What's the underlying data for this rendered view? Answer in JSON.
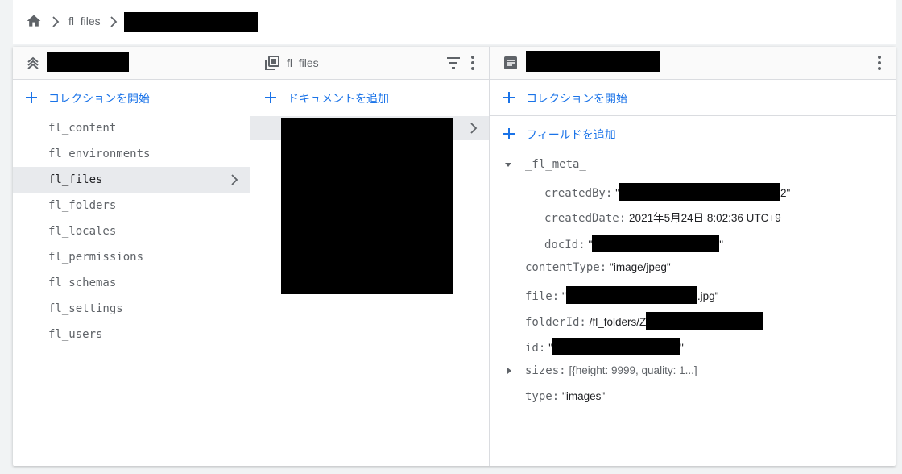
{
  "breadcrumb": {
    "items": [
      "fl_files"
    ]
  },
  "collections_panel": {
    "add_label": "コレクションを開始",
    "items": [
      {
        "label": "fl_content"
      },
      {
        "label": "fl_environments"
      },
      {
        "label": "fl_files",
        "selected": true
      },
      {
        "label": "fl_folders"
      },
      {
        "label": "fl_locales"
      },
      {
        "label": "fl_permissions"
      },
      {
        "label": "fl_schemas"
      },
      {
        "label": "fl_settings"
      },
      {
        "label": "fl_users"
      }
    ]
  },
  "documents_panel": {
    "title": "fl_files",
    "add_label": "ドキュメントを追加"
  },
  "document_panel": {
    "add_collection_label": "コレクションを開始",
    "add_field_label": "フィールドを追加",
    "fields": {
      "meta_key": "_fl_meta_",
      "createdBy_key": "createdBy:",
      "createdBy_open": "\"",
      "createdBy_tail": "2\"",
      "createdDate_key": "createdDate:",
      "createdDate_val": "2021年5月24日 8:02:36 UTC+9",
      "docId_key": "docId:",
      "docId_open": "\"",
      "docId_tail": "\"",
      "contentType_key": "contentType:",
      "contentType_val": "\"image/jpeg\"",
      "file_key": "file:",
      "file_open": "\"",
      "file_tail": ".jpg\"",
      "folderId_key": "folderId:",
      "folderId_val": "/fl_folders/Z",
      "id_key": "id:",
      "id_open": "\"",
      "id_tail": "\"",
      "sizes_key": "sizes:",
      "sizes_val": "[{height: 9999, quality: 1...]",
      "type_key": "type:",
      "type_val": "\"images\""
    }
  },
  "colors": {
    "accent": "#1a73e8",
    "selected_bg": "#e8eaed",
    "border": "#dadce0"
  },
  "icons": [
    "home-icon",
    "chevron-right-icon",
    "database-icon",
    "collection-icon",
    "filter-icon",
    "more-vert-icon",
    "document-icon",
    "plus-icon",
    "triangle-down-icon",
    "triangle-right-icon"
  ]
}
